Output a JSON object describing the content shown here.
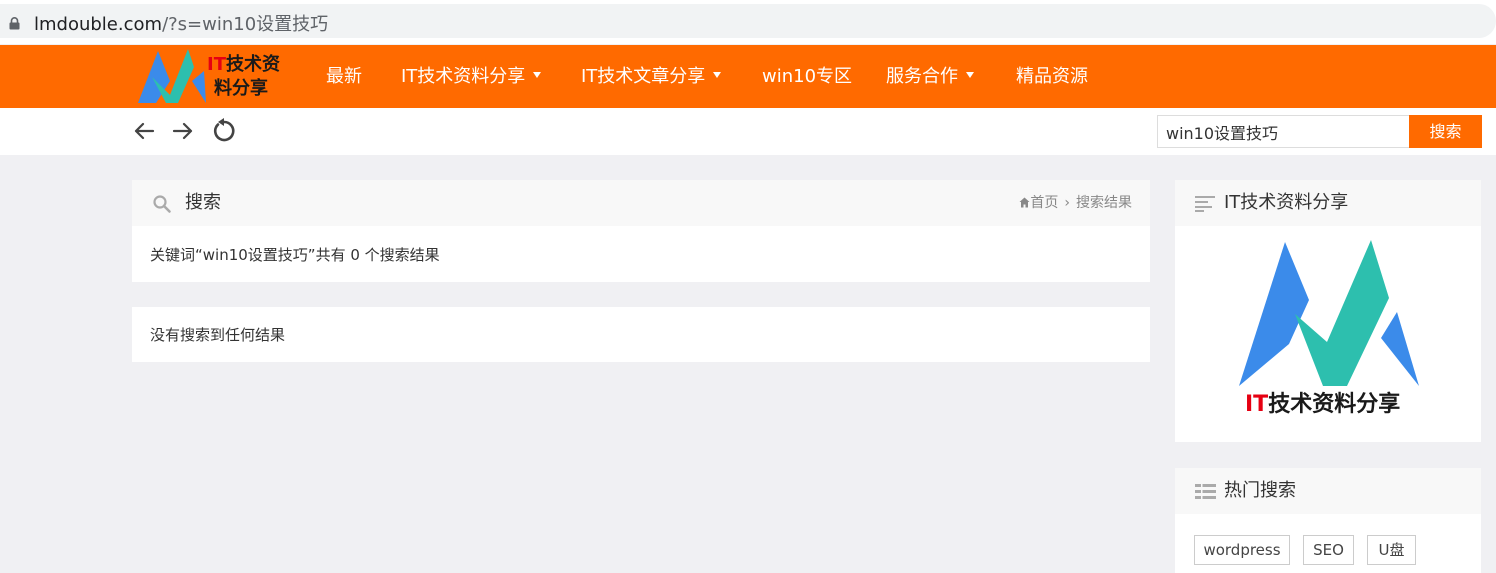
{
  "browser": {
    "url_domain": "lmdouble.com",
    "url_path": "/?s=win10设置技巧"
  },
  "logo": {
    "line1_red": "IT",
    "line1_rest": "技术资",
    "line2": "料分享"
  },
  "nav": {
    "items": [
      {
        "label": "最新"
      },
      {
        "label": "IT技术资料分享"
      },
      {
        "label": "IT技术文章分享"
      },
      {
        "label": "win10专区"
      },
      {
        "label": "服务合作"
      },
      {
        "label": "精品资源"
      }
    ]
  },
  "toolbar": {
    "search_value": "win10设置技巧",
    "search_button": "搜索"
  },
  "search_panel": {
    "title": "搜索",
    "breadcrumb_home": "首页",
    "breadcrumb_sep": "›",
    "breadcrumb_current": "搜索结果",
    "summary": "关键词“win10设置技巧”共有 0 个搜索结果"
  },
  "results_panel": {
    "message": "没有搜索到任何结果"
  },
  "sidebar": {
    "widget1_title": "IT技术资料分享",
    "widget1_caption_red": "IT",
    "widget1_caption_rest": "技术资料分享",
    "widget2_title": "热门搜索",
    "tags": [
      "wordpress",
      "SEO",
      "U盘"
    ]
  },
  "colors": {
    "brand": "#ff6a00",
    "logo_blue": "#3b8bea",
    "logo_teal": "#2dbfae",
    "logo_red": "#e60012"
  }
}
